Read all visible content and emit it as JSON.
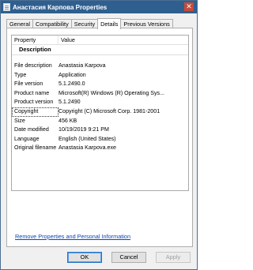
{
  "window": {
    "title": "Анастасия Карпова Properties",
    "close_glyph": "✕"
  },
  "tabs": [
    {
      "label": "General"
    },
    {
      "label": "Compatibility"
    },
    {
      "label": "Security"
    },
    {
      "label": "Details"
    },
    {
      "label": "Previous Versions"
    }
  ],
  "active_tab": "Details",
  "details": {
    "columns": {
      "property": "Property",
      "value": "Value"
    },
    "group": "Description",
    "rows": [
      {
        "property": "File description",
        "value": "Anastasia Karpova"
      },
      {
        "property": "Type",
        "value": "Application"
      },
      {
        "property": "File version",
        "value": "5.1.2490.0"
      },
      {
        "property": "Product name",
        "value": "Microsoft(R) Windows (R) Operating Sys..."
      },
      {
        "property": "Product version",
        "value": "5.1.2490"
      },
      {
        "property": "Copyright",
        "value": "Copyright (C) Microsoft Corp. 1981-2001"
      },
      {
        "property": "Size",
        "value": "456 KB"
      },
      {
        "property": "Date modified",
        "value": "10/19/2019 9:21 PM"
      },
      {
        "property": "Language",
        "value": "English (United States)"
      },
      {
        "property": "Original filename",
        "value": "Anastasia Karpova.exe"
      }
    ]
  },
  "remove_link": "Remove Properties and Personal Information",
  "buttons": {
    "ok": "OK",
    "cancel": "Cancel",
    "apply": "Apply"
  },
  "colors": {
    "titlebar": "#2f5f8f",
    "link": "#0a46b4"
  },
  "icons": {
    "app": "document-icon"
  }
}
